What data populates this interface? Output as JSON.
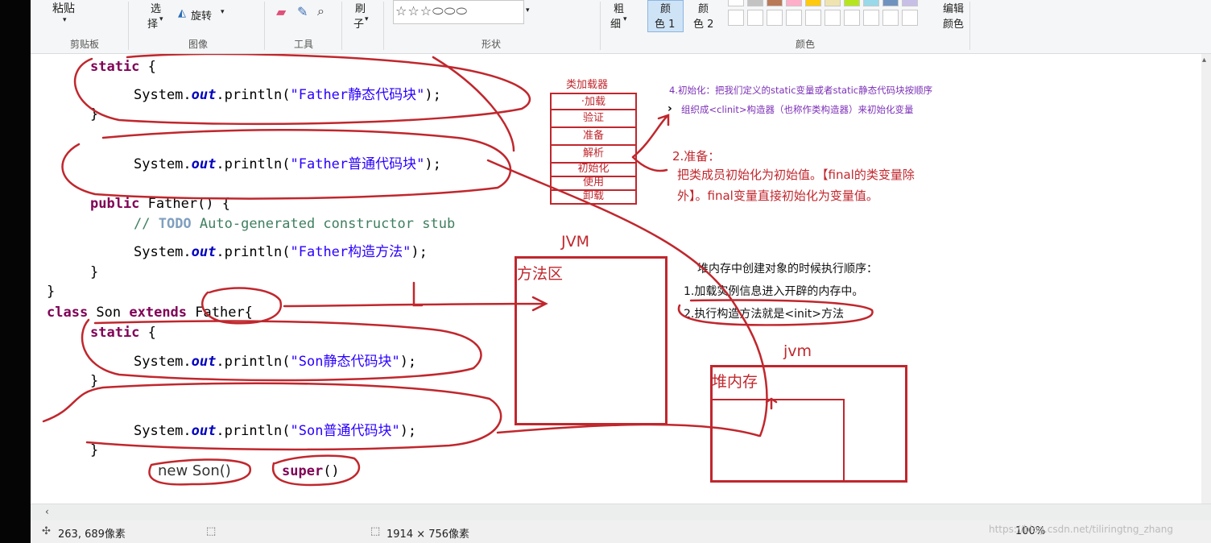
{
  "ribbon": {
    "paste_label": "粘贴",
    "select_label_1": "选",
    "select_label_2": "择",
    "rotate_label": "旋转",
    "brush_label_1": "刷",
    "brush_label_2": "子",
    "shapes_row": "☆☆☆⬭⬭⬭",
    "size_label_1": "粗",
    "size_label_2": "细",
    "color1_label_1": "颜",
    "color1_label_2": "色 1",
    "color2_label_1": "颜",
    "color2_label_2": "色 2",
    "edit_colors_1": "编辑",
    "edit_colors_2": "颜色",
    "groups": {
      "clipboard": "剪贴板",
      "image": "图像",
      "tools": "工具",
      "shapes": "形状",
      "colors": "颜色"
    },
    "palette_top": [
      "#ffffff",
      "#c3c3c3",
      "#b97a57",
      "#ffaec9",
      "#ffc90e",
      "#efe4b0",
      "#b5e61d",
      "#99d9ea",
      "#7092be",
      "#c8bfe7"
    ]
  },
  "canvas": {
    "code": {
      "static_kw": "static",
      "brace_open": " {",
      "brace_close": "}",
      "sys_a": "System.",
      "out": "out",
      "println": ".println(",
      "close_stmt": ");",
      "father_static_str": "\"Father静态代码块\"",
      "father_normal_str": "\"Father普通代码块\"",
      "public_kw": "public",
      "ctor_sig": " Father() {",
      "comment_a": "// ",
      "todo": "TODO",
      "comment_b": " Auto-generated constructor stub",
      "father_ctor_str": "\"Father构造方法\"",
      "class_kw": "class",
      "son_name": " Son ",
      "extends_kw": "extends",
      "father_ref": " Father{",
      "son_static_str": "\"Son静态代码块\"",
      "son_normal_str": "\"Son普通代码块\"",
      "new_son": "new Son()",
      "super_kw": "super",
      "super_parens": "()"
    },
    "loader": {
      "title": "类加载器",
      "stages": [
        "·加载",
        "验证",
        "准备",
        "解析",
        "初始化",
        "使用",
        "卸载"
      ]
    },
    "init_note": {
      "line1": "4.初始化：把我们定义的static变量或者static静态代码块按顺序",
      "line2": "组织成<clinit>构造器（也称作类构造器）来初始化变量"
    },
    "prepare_note": {
      "line1": "2.准备：",
      "line2": "把类成员初始化为初始值。【final的类变量除",
      "line3": "外】。final变量直接初始化为变量值。"
    },
    "jvm_label": "JVM",
    "method_area": "方法区",
    "heap_note": {
      "title": "堆内存中创建对象的时候执行顺序：",
      "line1": "1.加载实例信息进入开辟的内存中。",
      "line2": "2.执行构造方法就是<init>方法"
    },
    "jvm_small": "jvm",
    "heap_label": "堆内存"
  },
  "status": {
    "cursor_pos": "263, 689像素",
    "image_size": "1914 × 756像素",
    "zoom": "100%",
    "watermark": "https://blog.csdn.net/tiliringtng_zhang"
  },
  "colors": {
    "ink_red": "#c0272d",
    "keyword": "#7f0055",
    "field": "#0000c0",
    "string": "#2a00ff",
    "comment": "#3f7f5f"
  }
}
